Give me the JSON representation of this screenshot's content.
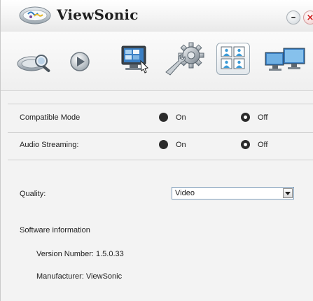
{
  "window": {
    "title": "ViewSonic",
    "minimize_glyph": "–",
    "close_glyph": "×"
  },
  "toolbar": {
    "items": [
      {
        "icon": "search-camera-icon",
        "active": false
      },
      {
        "icon": "play-icon",
        "active": false
      },
      {
        "icon": "monitor-display-icon",
        "active": false
      },
      {
        "icon": "settings-gear-icon",
        "active": false
      },
      {
        "icon": "quad-view-icon",
        "active": true
      },
      {
        "icon": "multi-monitor-icon",
        "active": false
      }
    ]
  },
  "settings": {
    "compatible_mode": {
      "label": "Compatible Mode",
      "on_label": "On",
      "off_label": "Off",
      "selected": "Off"
    },
    "audio_streaming": {
      "label": "Audio Streaming:",
      "on_label": "On",
      "off_label": "Off",
      "selected": "Off"
    },
    "quality": {
      "label": "Quality:",
      "value": "Video"
    }
  },
  "software_info": {
    "heading": "Software information",
    "version": "Version Number: 1.5.0.33",
    "manufacturer": "Manufacturer: ViewSonic"
  },
  "colors": {
    "accent_blue": "#3a7fc4",
    "close_red": "#d11d1d"
  }
}
